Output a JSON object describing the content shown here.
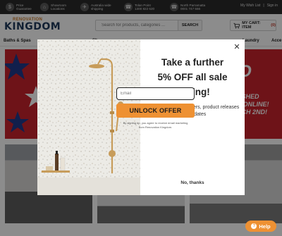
{
  "topbar": {
    "items": [
      {
        "icon": "price-guarantee-icon",
        "text": "Price\nGuarantee"
      },
      {
        "icon": "showroom-icon",
        "text": "Showroom\nLocations"
      },
      {
        "icon": "shipping-icon",
        "text": "Australia wide\nshipping"
      },
      {
        "icon": "phone-icon",
        "text": "Tolan Point\n1300 822 620"
      },
      {
        "icon": "phone-icon",
        "text": "North Parramatta\n0001 747 556"
      }
    ],
    "wishlist_label": "My Wish List",
    "signin_label": "Sign in"
  },
  "header": {
    "logo_top": "RENOVATION",
    "logo_main": "KINGDOM",
    "search_placeholder": "Search for products, categories ...",
    "search_button": "SEARCH",
    "cart_label": "MY CART: ITEM",
    "cart_count": "(0)"
  },
  "nav": {
    "items": [
      "Baths & Spas",
      "Sh",
      "Laundry",
      "Acce"
    ]
  },
  "background": {
    "banner_text1": "O",
    "banner_text2": "ASHED\nS ONLINE!\nRCH 2ND!"
  },
  "modal": {
    "title": "Take a further\n5% OFF all sale\npricing!",
    "subtitle": "Sign up for special offers, product releases and updates",
    "email_placeholder": "Email",
    "unlock_button": "UNLOCK OFFER",
    "legal": "By signing up, you agree to receive email marketing from Renovation Kingdom.",
    "no_thanks": "No, thanks",
    "close_symbol": "✕"
  },
  "help": {
    "label": "Help",
    "icon_symbol": "?"
  },
  "colors": {
    "accent": "#ee9133",
    "banner_red": "#c8232c",
    "logo_navy": "#1f3a5c"
  }
}
